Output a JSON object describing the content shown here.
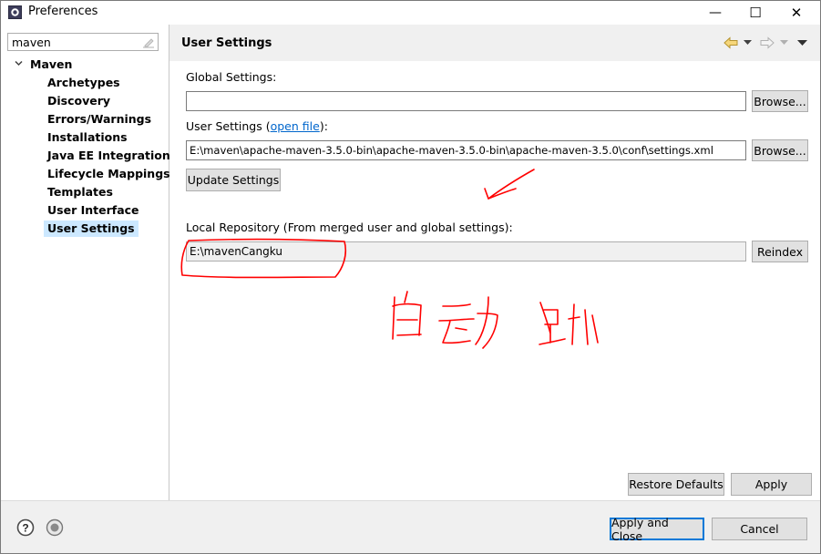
{
  "window": {
    "title": "Preferences",
    "minimize_glyph": "—",
    "maximize_glyph": "☐",
    "close_glyph": "✕"
  },
  "filter": {
    "value": "maven"
  },
  "tree": {
    "root": "Maven",
    "items": [
      {
        "label": "Archetypes"
      },
      {
        "label": "Discovery"
      },
      {
        "label": "Errors/Warnings"
      },
      {
        "label": "Installations"
      },
      {
        "label": "Java EE Integration"
      },
      {
        "label": "Lifecycle Mappings"
      },
      {
        "label": "Templates"
      },
      {
        "label": "User Interface"
      },
      {
        "label": "User Settings",
        "selected": true
      }
    ]
  },
  "page": {
    "title": "User Settings",
    "global_settings_label": "Global Settings:",
    "global_settings_value": "",
    "browse_label": "Browse...",
    "user_settings_label_prefix": "User Settings (",
    "open_file_link": "open file",
    "user_settings_label_suffix": "):",
    "user_settings_value": "E:\\maven\\apache-maven-3.5.0-bin\\apache-maven-3.5.0-bin\\apache-maven-3.5.0\\conf\\settings.xml",
    "update_settings_label": "Update Settings",
    "local_repo_label": "Local Repository (From merged user and global settings):",
    "local_repo_value": "E:\\mavenCangku",
    "reindex_label": "Reindex",
    "restore_defaults_label": "Restore Defaults",
    "apply_label": "Apply"
  },
  "footer": {
    "apply_close_label": "Apply and Close",
    "cancel_label": "Cancel",
    "help_glyph": "?"
  },
  "colors": {
    "selection": "#cce8ff",
    "link": "#0066cc",
    "default_button_border": "#0078d7",
    "annotation_ink": "#ff0000"
  },
  "icons": [
    "eclipse-preferences-icon",
    "clear-filter-icon",
    "tree-expanded-arrow-icon",
    "back-arrow-icon",
    "forward-arrow-icon",
    "menu-dropdown-icon",
    "help-icon",
    "import-export-icon"
  ]
}
